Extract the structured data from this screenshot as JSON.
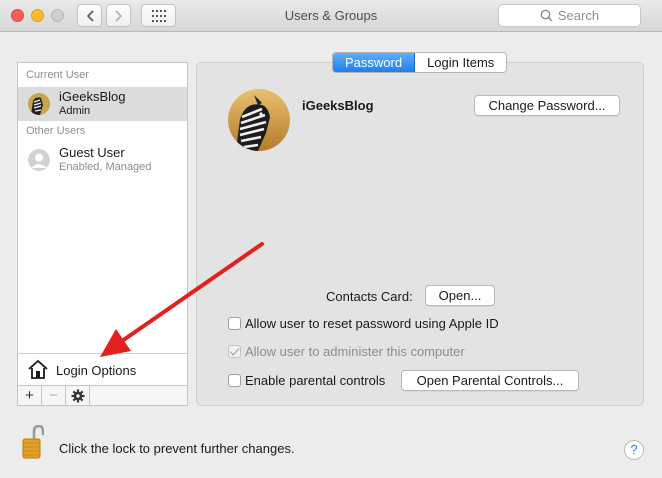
{
  "window": {
    "title": "Users & Groups"
  },
  "search": {
    "placeholder": "Search"
  },
  "sidebar": {
    "current_user_header": "Current User",
    "other_users_header": "Other Users",
    "users": [
      {
        "name": "iGeeksBlog",
        "role": "Admin"
      },
      {
        "name": "Guest User",
        "role": "Enabled, Managed"
      }
    ],
    "login_options_label": "Login Options",
    "bottom_buttons": [
      "+",
      "−",
      "gear-icon"
    ]
  },
  "tabs": [
    {
      "label": "Password",
      "active": true
    },
    {
      "label": "Login Items",
      "active": false
    }
  ],
  "main": {
    "user_name": "iGeeksBlog",
    "change_password_label": "Change Password...",
    "contacts_card_label": "Contacts Card:",
    "open_label": "Open...",
    "options": [
      {
        "label": "Allow user to reset password using Apple ID",
        "checked": false,
        "enabled": true
      },
      {
        "label": "Allow user to administer this computer",
        "checked": true,
        "enabled": false
      },
      {
        "label": "Enable parental controls",
        "checked": false,
        "enabled": true
      }
    ],
    "open_parental_controls_label": "Open Parental Controls..."
  },
  "footer": {
    "lock_text": "Click the lock to prevent further changes.",
    "help_label": "?"
  },
  "colors": {
    "accent": "#1f7ef2",
    "arrow": "#e3201b"
  }
}
